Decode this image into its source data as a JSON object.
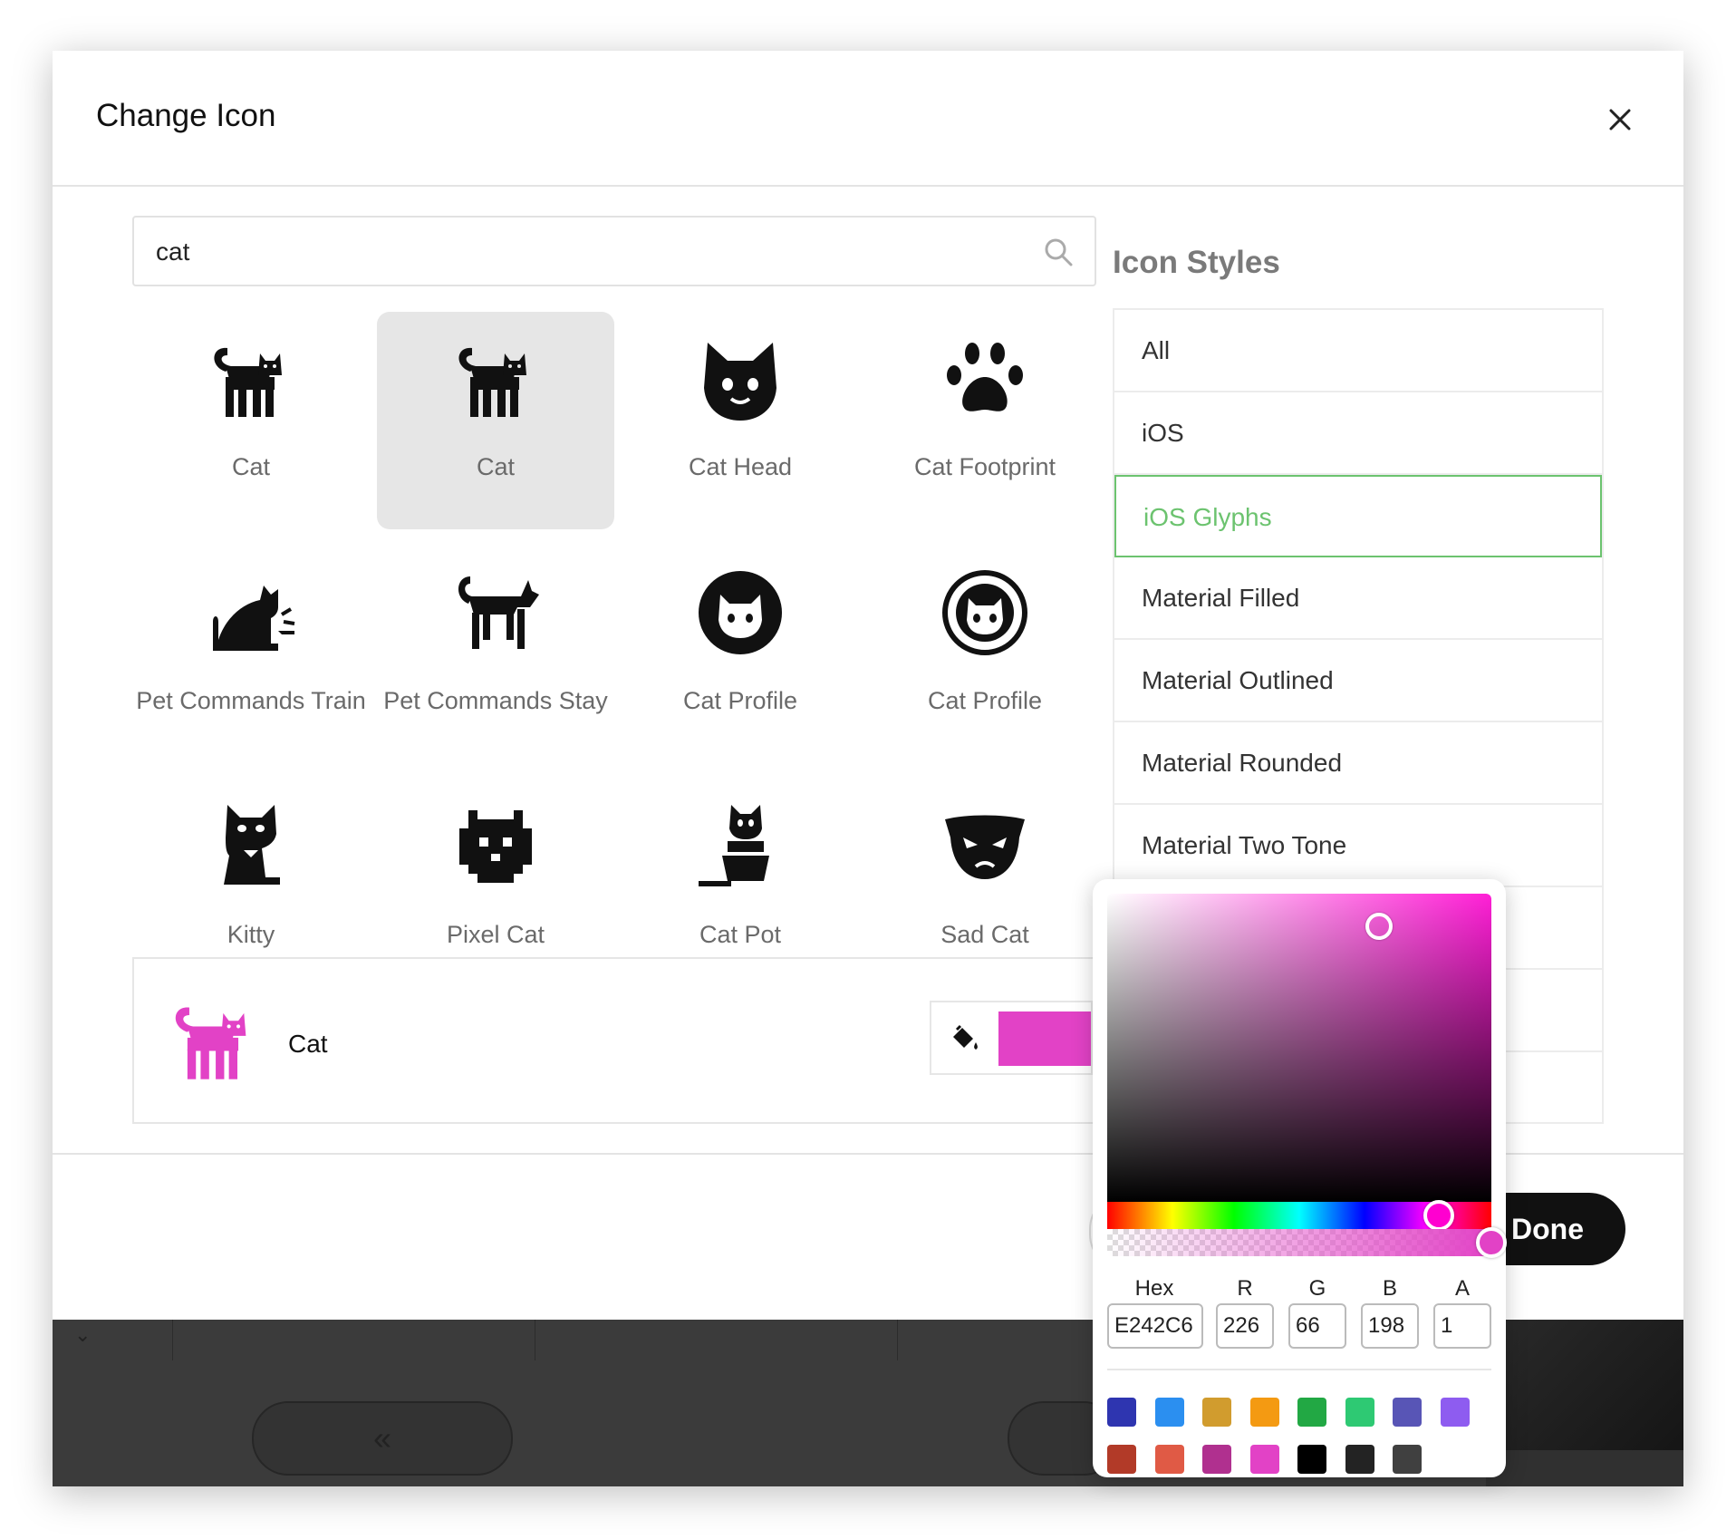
{
  "dialog": {
    "title": "Change Icon"
  },
  "search": {
    "value": "cat"
  },
  "icons": [
    {
      "label": "Cat",
      "glyph": "cat-icon"
    },
    {
      "label": "Cat",
      "glyph": "cat-icon",
      "selected": true
    },
    {
      "label": "Cat Head",
      "glyph": "cat-head-icon"
    },
    {
      "label": "Cat Footprint",
      "glyph": "cat-footprint-icon"
    },
    {
      "label": "Pet Commands Train",
      "glyph": "pet-commands-train-icon"
    },
    {
      "label": "Pet Commands Stay",
      "glyph": "pet-commands-stay-icon"
    },
    {
      "label": "Cat Profile",
      "glyph": "cat-profile-icon"
    },
    {
      "label": "Cat Profile",
      "glyph": "cat-profile-outline-icon"
    },
    {
      "label": "Kitty",
      "glyph": "kitty-icon"
    },
    {
      "label": "Pixel Cat",
      "glyph": "pixel-cat-icon"
    },
    {
      "label": "Cat Pot",
      "glyph": "cat-pot-icon"
    },
    {
      "label": "Sad Cat",
      "glyph": "sad-cat-icon"
    }
  ],
  "preview": {
    "name": "Cat",
    "color": "#E242C6"
  },
  "icon_styles": {
    "heading": "Icon Styles",
    "items": [
      {
        "label": "All"
      },
      {
        "label": "iOS"
      },
      {
        "label": "iOS Glyphs",
        "active": true
      },
      {
        "label": "Material Filled"
      },
      {
        "label": "Material Outlined"
      },
      {
        "label": "Material Rounded"
      },
      {
        "label": "Material Two Tone"
      },
      {
        "label": ""
      },
      {
        "label": ""
      },
      {
        "label": ""
      }
    ]
  },
  "footer": {
    "done_label": "Done"
  },
  "color_picker": {
    "hex_label": "Hex",
    "r_label": "R",
    "g_label": "G",
    "b_label": "B",
    "a_label": "A",
    "hex": "E242C6",
    "r": "226",
    "g": "66",
    "b": "198",
    "a": "1",
    "hue_deg": 311,
    "alpha": 1,
    "presets": [
      "#2e35b0",
      "#2b8ff0",
      "#d19c2e",
      "#f49a12",
      "#22a844",
      "#2ec973",
      "#5855b6",
      "#8e5cf0",
      "#b23a28",
      "#e05a45",
      "#b0308f",
      "#e242c6",
      "#000000",
      "#232323",
      "#404040"
    ]
  },
  "colors": {
    "accent": "#6cc36f",
    "primary_dark": "#111111"
  }
}
